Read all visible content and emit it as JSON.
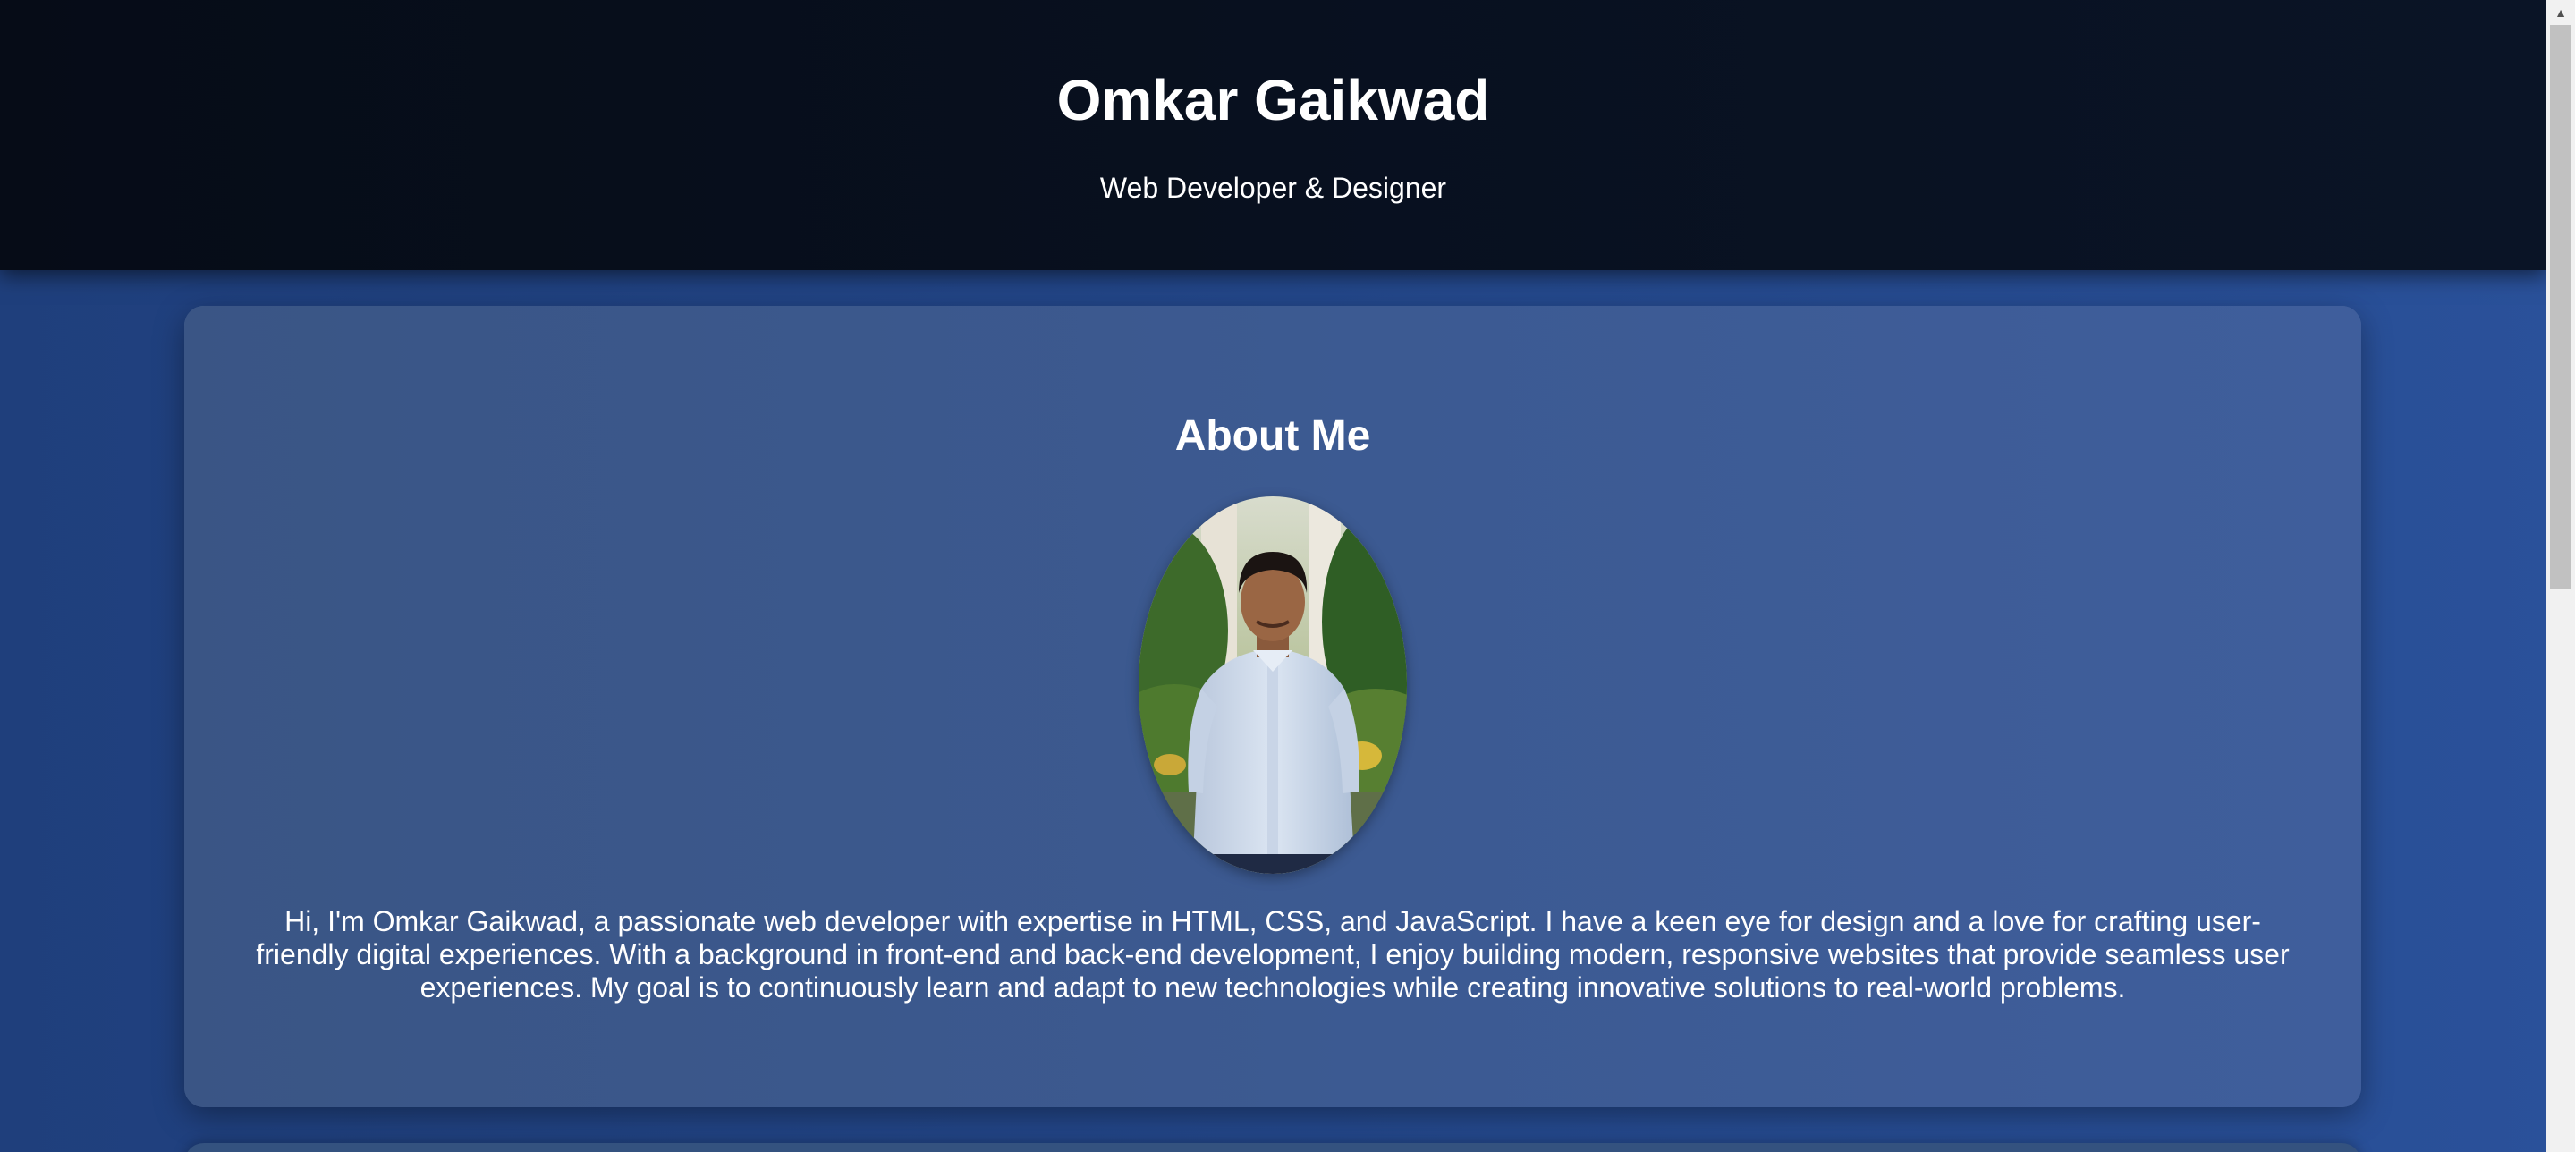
{
  "header": {
    "title": "Omkar Gaikwad",
    "subtitle": "Web Developer & Designer"
  },
  "about": {
    "heading": "About Me",
    "photo_alt": "Omkar Gaikwad",
    "text": "Hi, I'm Omkar Gaikwad, a passionate web developer with expertise in HTML, CSS, and JavaScript. I have a keen eye for design and a love for crafting user-friendly digital experiences. With a background in front-end and back-end development, I enjoy building modern, responsive websites that provide seamless user experiences. My goal is to continuously learn and adapt to new technologies while creating innovative solutions to real-world problems."
  },
  "colors": {
    "page_background": "#24488c",
    "header_background": "#08101f",
    "card_background": "#3c5a92",
    "text": "#ffffff"
  },
  "icons": {
    "scroll_up": "scroll-up-arrow-icon"
  }
}
